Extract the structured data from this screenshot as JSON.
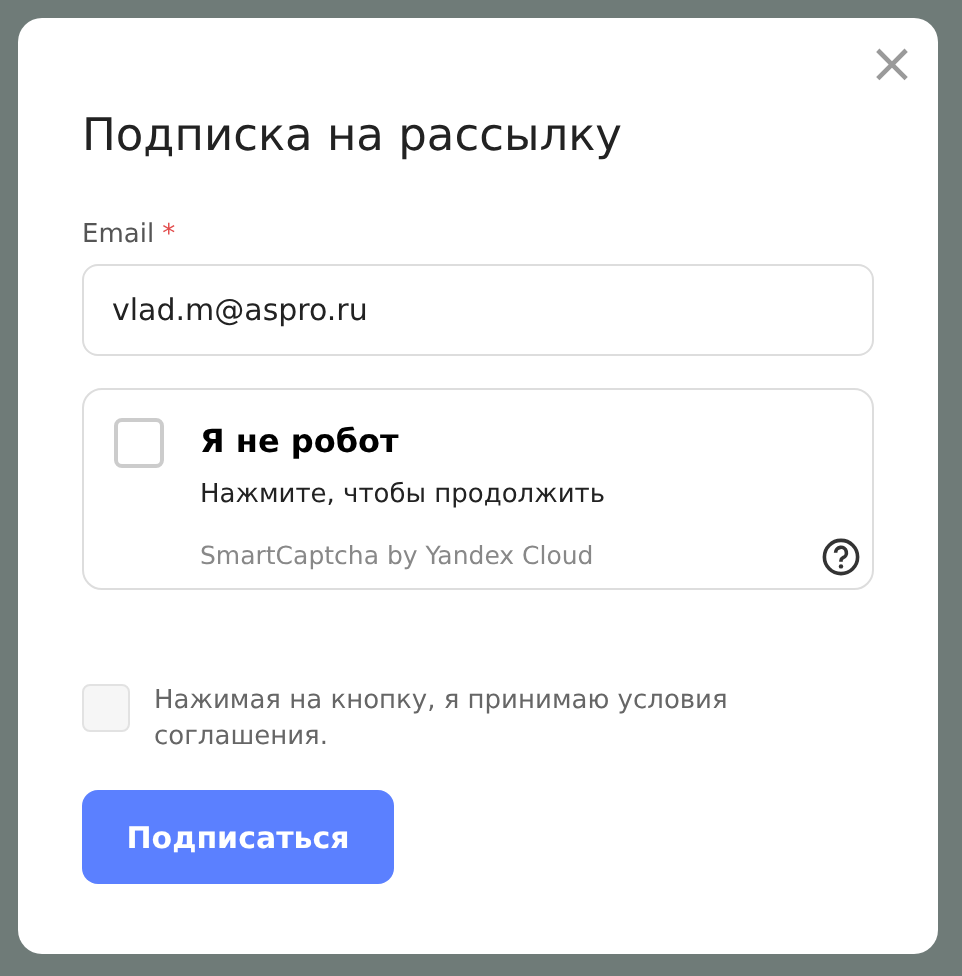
{
  "dialog": {
    "title": "Подписка на рассылку",
    "close": "×"
  },
  "email": {
    "label": "Email",
    "required_mark": "*",
    "value": "vlad.m@aspro.ru"
  },
  "captcha": {
    "checked": false,
    "title": "Я не робот",
    "hint": "Нажмите, чтобы продолжить",
    "brand": "SmartCaptcha by Yandex Cloud"
  },
  "agreement": {
    "checked": false,
    "text": "Нажимая на кнопку, я принимаю условия соглашения."
  },
  "submit": "Подписаться"
}
